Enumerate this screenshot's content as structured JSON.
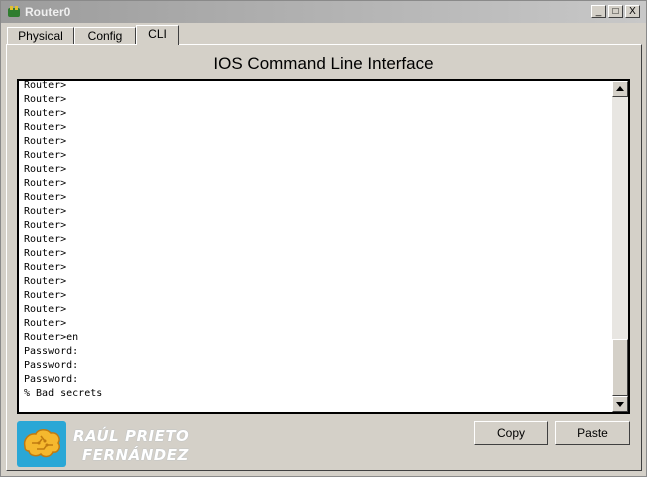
{
  "window": {
    "title": "Router0"
  },
  "title_buttons": {
    "minimize": "_",
    "maximize": "□",
    "close": "X"
  },
  "tabs": [
    {
      "label": "Physical",
      "active": false
    },
    {
      "label": "Config",
      "active": false
    },
    {
      "label": "CLI",
      "active": true
    }
  ],
  "heading": "IOS Command Line Interface",
  "console": {
    "lines": [
      "Router>",
      "Router>",
      "Router>",
      "Router>",
      "Router>",
      "Router>",
      "Router>",
      "Router>",
      "Router>",
      "Router>",
      "Router>",
      "Router>",
      "Router>",
      "Router>",
      "Router>",
      "Router>",
      "Router>",
      "Router>",
      "Router>en",
      "Password:",
      "Password:",
      "Password:",
      "% Bad secrets",
      "",
      "Router>"
    ]
  },
  "buttons": {
    "copy": "Copy",
    "paste": "Paste"
  },
  "watermark": {
    "line1": "RAÚL PRIETO",
    "line2": "FERNÁNDEZ"
  },
  "colors": {
    "accent": "#2aa7d6",
    "logo_brain": "#f5b82e"
  },
  "icons": {
    "router": "router-icon",
    "logo": "brain-logo-icon"
  }
}
